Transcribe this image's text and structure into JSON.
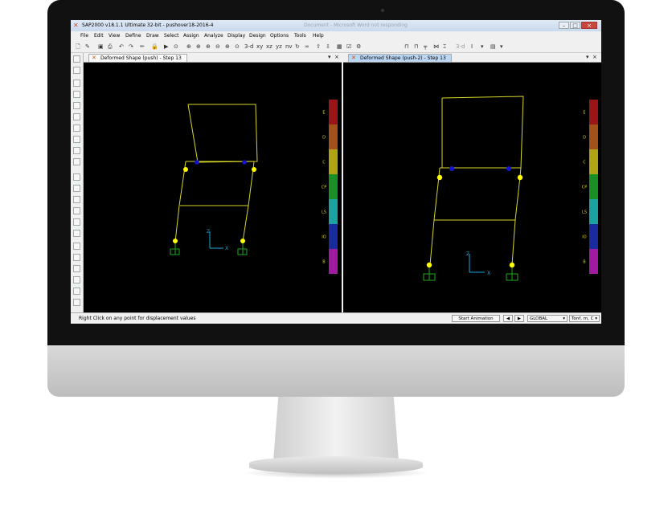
{
  "window": {
    "title": "SAP2000 v18.1.1 Ultimate 32-bit - pushover18-2016-4",
    "title_ghost": "Document - Microsoft Word not responding",
    "controls": {
      "minimize": "–",
      "maximize": "□",
      "close": "×"
    }
  },
  "menu": [
    "File",
    "Edit",
    "View",
    "Define",
    "Draw",
    "Select",
    "Assign",
    "Analyze",
    "Display",
    "Design",
    "Options",
    "Tools",
    "Help"
  ],
  "toolbar": {
    "view_3d": "3-d",
    "view_xy": "xy",
    "view_xz": "xz",
    "view_yz": "yz",
    "view_nv": "nv",
    "view_3d_b": "3-d"
  },
  "panes": [
    {
      "tab": "Deformed Shape (push) - Step 13",
      "active": false
    },
    {
      "tab": "Deformed Shape (push-2) - Step 13",
      "active": true
    }
  ],
  "axis_labels": {
    "z": "Z",
    "x": "X"
  },
  "legend": {
    "labels": [
      "E",
      "D",
      "C",
      "CP",
      "LS",
      "IO",
      "B"
    ],
    "colors": [
      "#9b1416",
      "#a2511b",
      "#b0a314",
      "#1a8f25",
      "#1aa3a0",
      "#1a2a9f",
      "#a01aa2"
    ]
  },
  "status": {
    "message": "Right Click on any point for displacement values",
    "animation_button": "Start Animation",
    "coord_system": "GLOBAL",
    "units": "Tonf, m, C"
  },
  "colors": {
    "frame": "#d8d62a",
    "hinge_yellow": "#ffff00",
    "hinge_blue": "#1414d6",
    "support": "#1ea81e",
    "axes": "#1aa7d6"
  }
}
